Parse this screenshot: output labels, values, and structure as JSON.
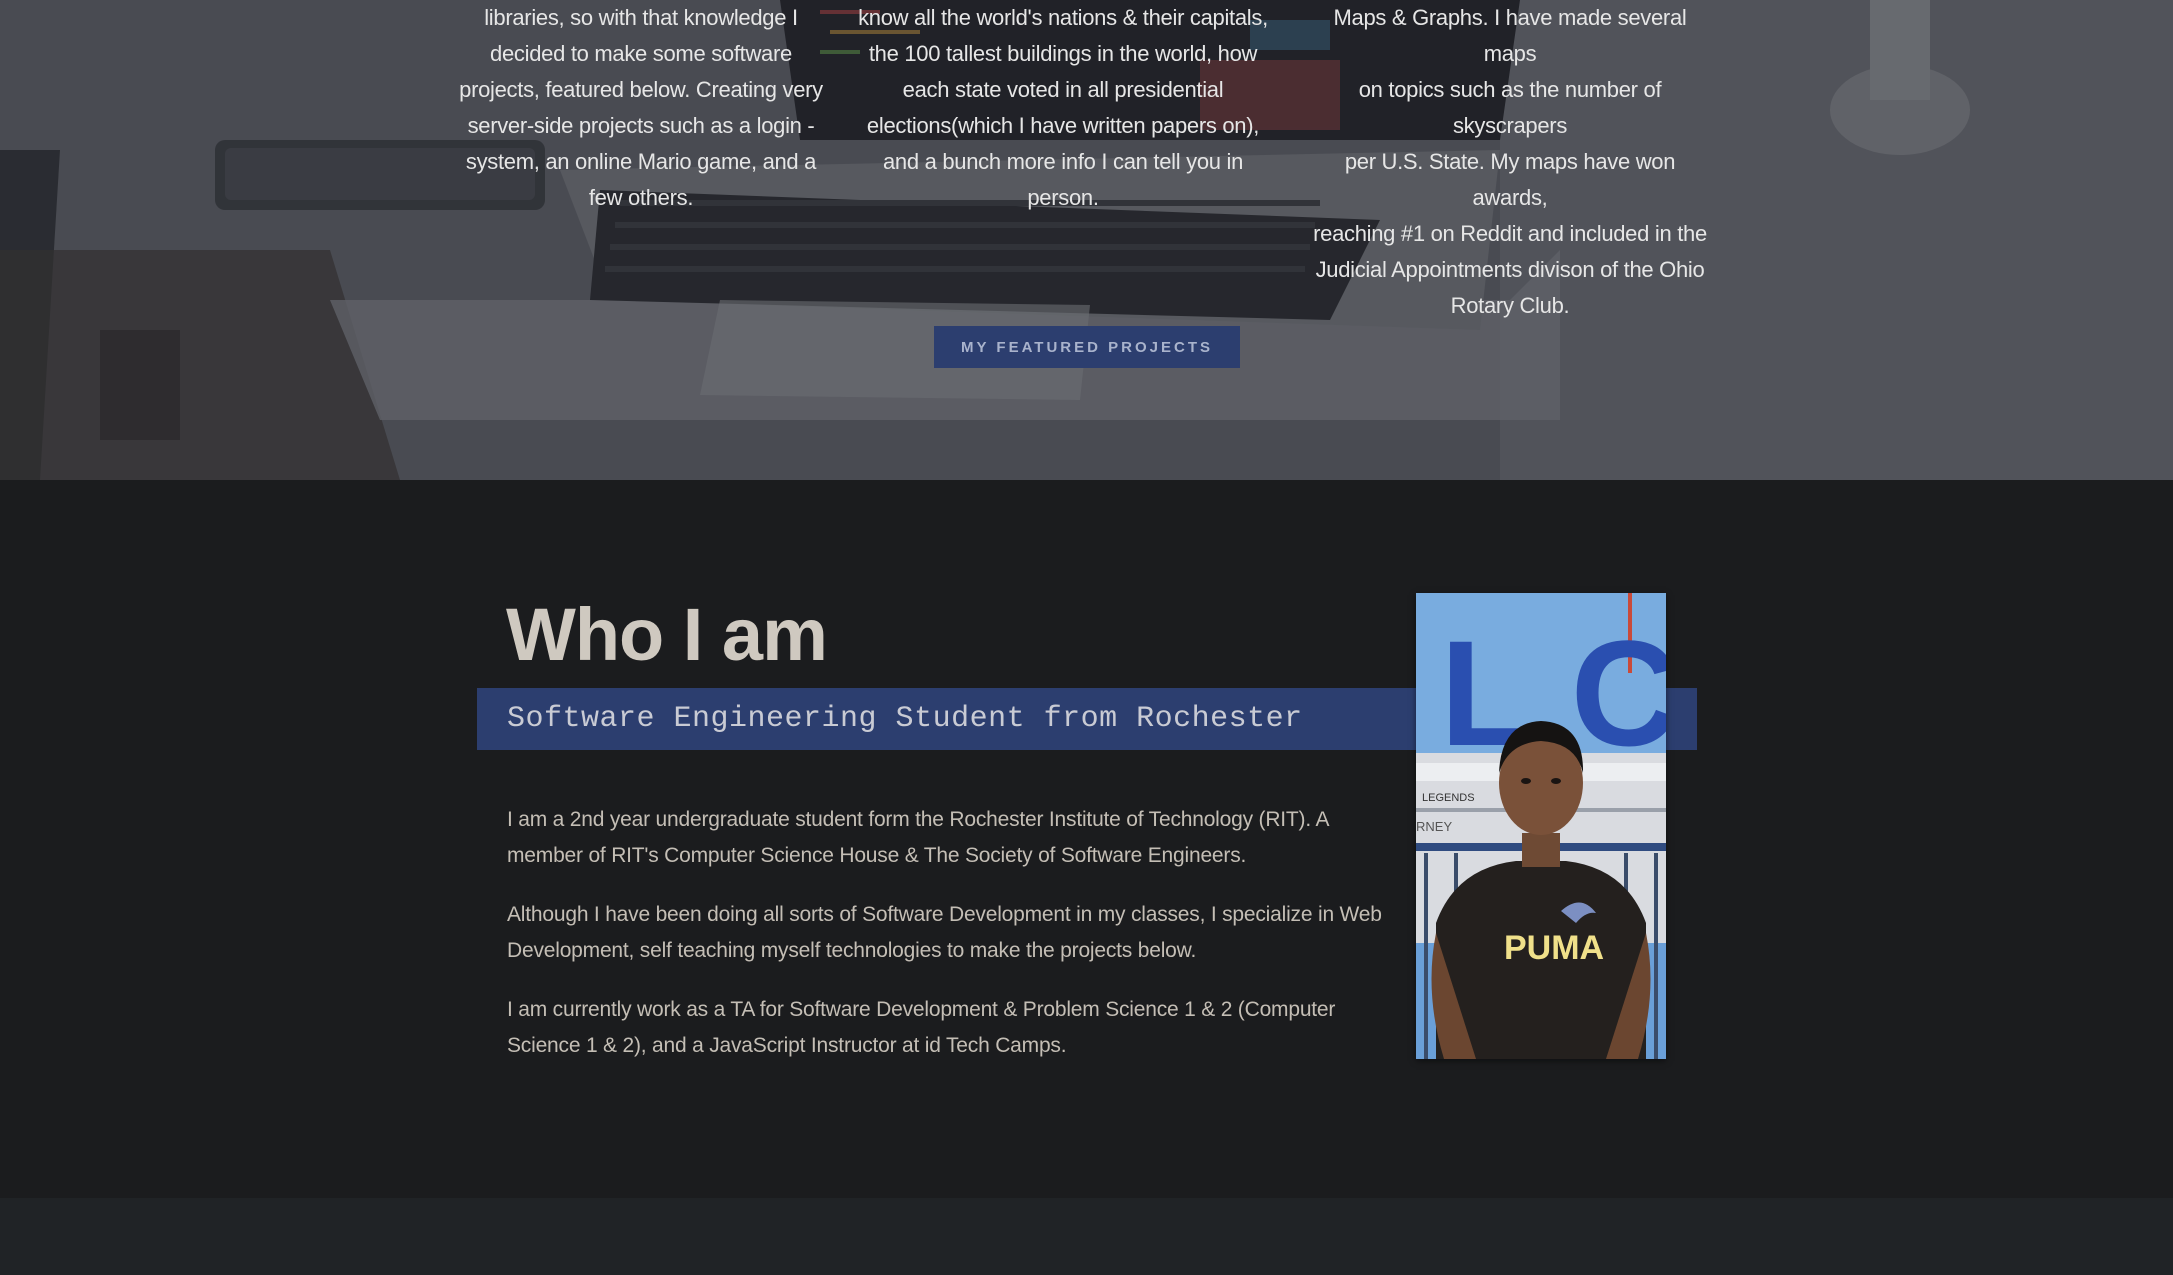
{
  "hero": {
    "columns": [
      {
        "lines": [
          "libraries, so with that knowledge I",
          "decided to make some software",
          "projects, featured below. Creating very",
          "server-side projects such as a login -",
          "system, an online Mario game, and a",
          "few others."
        ]
      },
      {
        "lines": [
          "know all the world's nations & their capitals,",
          "the 100 tallest buildings in the world, how",
          "each state voted in all presidential",
          "elections(which I have written papers on),",
          "and a bunch more info I can tell you in",
          "person."
        ]
      },
      {
        "lines": [
          "Maps & Graphs. I have made several maps",
          "on topics such as the number of skyscrapers",
          "per U.S. State. My maps have won awards,",
          "reaching #1 on Reddit and included in the",
          "Judicial Appointments divison of the Ohio",
          "Rotary Club."
        ]
      }
    ],
    "featured_button": "MY FEATURED PROJECTS"
  },
  "about": {
    "title": "Who I am",
    "subtitle": "Software Engineering Student from Rochester",
    "paragraphs": [
      "I am a 2nd year undergraduate student form the Rochester Institute of Technology (RIT). A member of RIT's Computer Science House & The Society of Software Engineers.",
      "Although I have been doing all sorts of Software Development in my classes, I specialize in Web Development, self teaching myself technologies to make the projects below.",
      "I am currently work as a TA for Software Development & Problem Science 1 & 2 (Computer Science 1 & 2), and a JavaScript Instructor at id Tech Camps."
    ],
    "photo": {
      "sign_letters": "L C",
      "sign_small_1": "LEGENDS",
      "sign_small_2": "RNEY",
      "shirt_text": "PUMA"
    }
  },
  "colors": {
    "accent_blue": "#2c3e6f",
    "dark_bg": "#1b1c1e",
    "footer_bg": "#202326",
    "title_text": "#cfc9c0",
    "body_text": "#c4beb5"
  }
}
